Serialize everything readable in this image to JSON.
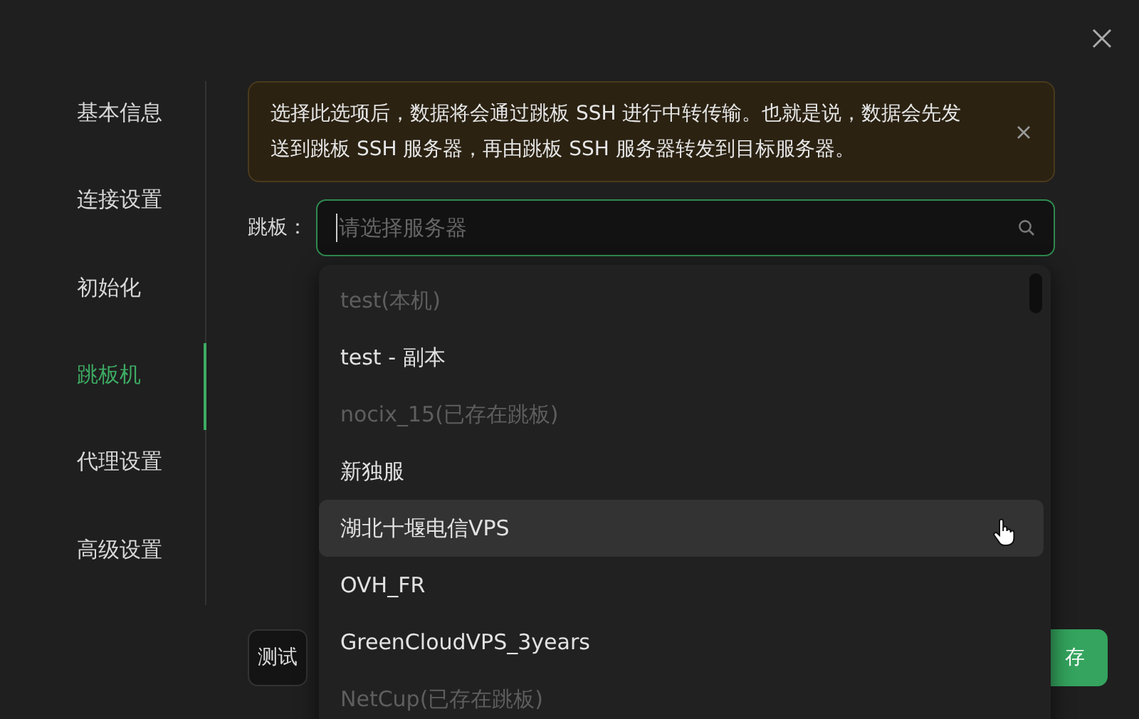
{
  "sidebar": {
    "items": [
      {
        "label": "基本信息",
        "selected": false
      },
      {
        "label": "连接设置",
        "selected": false
      },
      {
        "label": "初始化",
        "selected": false
      },
      {
        "label": "跳板机",
        "selected": true
      },
      {
        "label": "代理设置",
        "selected": false
      },
      {
        "label": "高级设置",
        "selected": false
      }
    ]
  },
  "alert": {
    "text": "选择此选项后，数据将会通过跳板 SSH 进行中转传输。也就是说，数据会先发送到跳板 SSH 服务器，再由跳板 SSH 服务器转发到目标服务器。"
  },
  "jump_field": {
    "label": "跳板：",
    "placeholder": "请选择服务器"
  },
  "dropdown": {
    "options": [
      {
        "label": "test(本机)",
        "disabled": true,
        "hovered": false
      },
      {
        "label": "test - 副本",
        "disabled": false,
        "hovered": false
      },
      {
        "label": "nocix_15(已存在跳板)",
        "disabled": true,
        "hovered": false
      },
      {
        "label": "新独服",
        "disabled": false,
        "hovered": false
      },
      {
        "label": "湖北十堰电信VPS",
        "disabled": false,
        "hovered": true
      },
      {
        "label": "OVH_FR",
        "disabled": false,
        "hovered": false
      },
      {
        "label": "GreenCloudVPS_3years",
        "disabled": false,
        "hovered": false
      },
      {
        "label": "NetCup(已存在跳板)",
        "disabled": true,
        "hovered": false
      }
    ]
  },
  "buttons": {
    "test": "测试",
    "save": "存"
  }
}
